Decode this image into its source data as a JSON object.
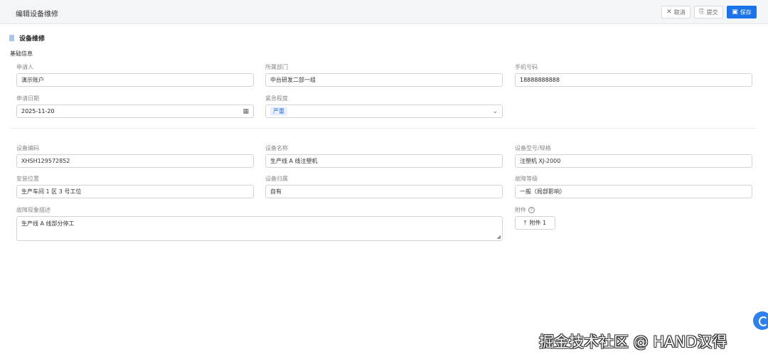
{
  "header": {
    "title": "编辑设备维修",
    "cancel_label": "取消",
    "submit_label": "提交",
    "save_label": "保存"
  },
  "section": {
    "title": "设备维修",
    "subtitle": "基础信息"
  },
  "basic": {
    "applicant": {
      "label": "申请人",
      "value": "演示账户"
    },
    "department": {
      "label": "所属部门",
      "value": "中台研发二部一组"
    },
    "phone": {
      "label": "手机号码",
      "value": "18888888888"
    },
    "apply_date": {
      "label": "申请日期",
      "value": "2025-11-20"
    },
    "urgency": {
      "label": "紧急程度",
      "value": "严重"
    }
  },
  "device": {
    "code": {
      "label": "设备编码",
      "value": "XHSH129572852"
    },
    "name": {
      "label": "设备名称",
      "value": "生产线 A 线注塑机"
    },
    "model": {
      "label": "设备型号/规格",
      "value": "注塑机 XJ-2000"
    },
    "location": {
      "label": "安装位置",
      "value": "生产车间 1 区 3 号工位"
    },
    "ownership": {
      "label": "设备归属",
      "value": "自有"
    },
    "fault_level": {
      "label": "故障等级",
      "value": "一般（局部影响）"
    },
    "fault_desc": {
      "label": "故障现象描述",
      "value": "生产线 A 线部分停工"
    },
    "attachment": {
      "label": "附件",
      "button": "附件 1"
    }
  },
  "watermark": "掘金技术社区 @ HAND汉得"
}
